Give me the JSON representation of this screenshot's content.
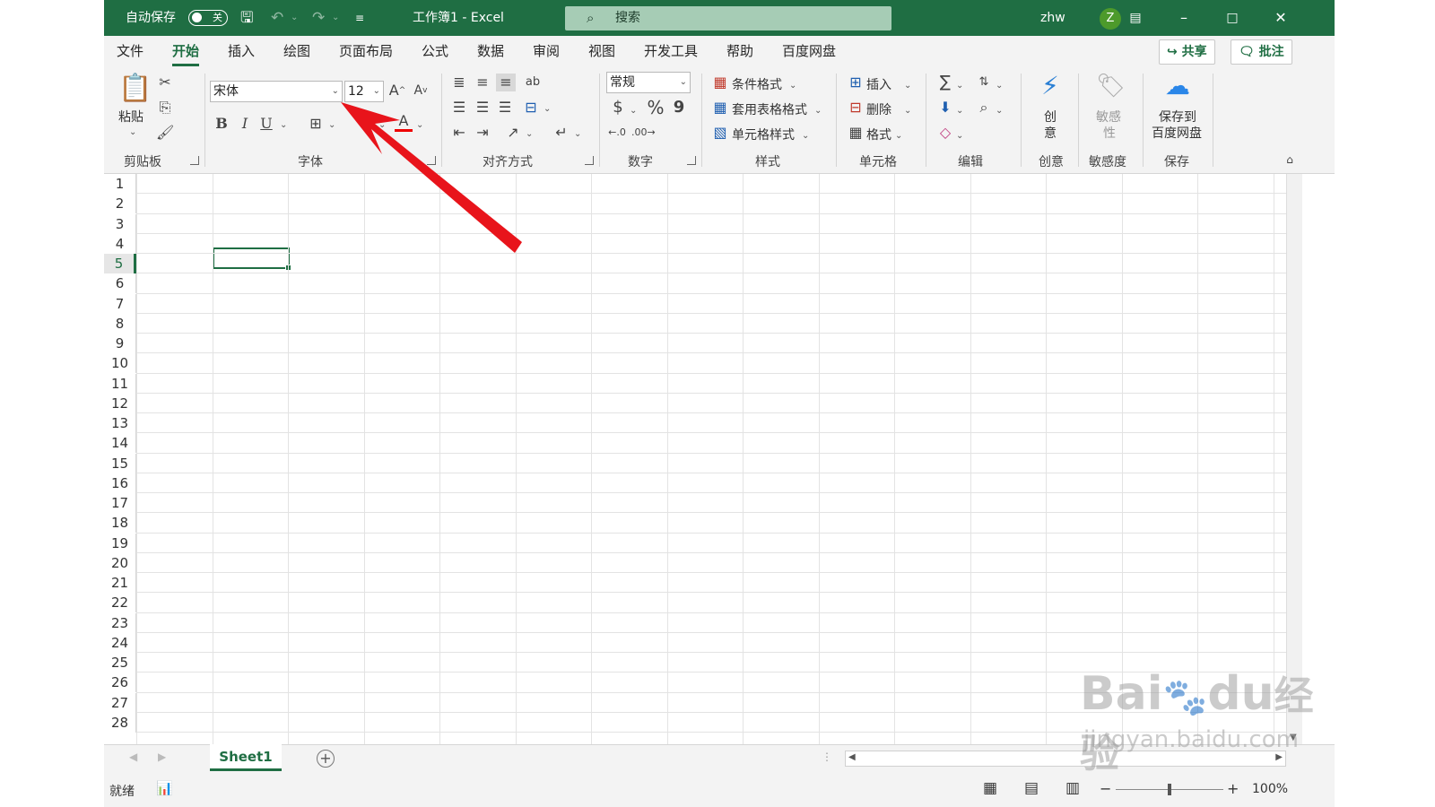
{
  "titlebar": {
    "autosave_label": "自动保存",
    "autosave_state": "关",
    "doc_title": "工作簿1  -  Excel",
    "search_placeholder": "搜索",
    "user_name": "zhw",
    "avatar_letter": "Z"
  },
  "menu": {
    "tabs": [
      "文件",
      "开始",
      "插入",
      "绘图",
      "页面布局",
      "公式",
      "数据",
      "审阅",
      "视图",
      "开发工具",
      "帮助",
      "百度网盘"
    ],
    "active_tab": "开始",
    "share_label": "共享",
    "comment_label": "批注"
  },
  "ribbon": {
    "clipboard": {
      "paste_label": "粘贴",
      "group_label": "剪贴板"
    },
    "font": {
      "font_name": "宋体",
      "font_size": "12",
      "bold": "B",
      "italic": "I",
      "underline": "U",
      "group_label": "字体"
    },
    "alignment": {
      "group_label": "对齐方式"
    },
    "number": {
      "format": "常规",
      "currency": "$",
      "percent": "%",
      "comma": "9",
      "group_label": "数字"
    },
    "styles": {
      "conditional": "条件格式",
      "table": "套用表格格式",
      "cell": "单元格样式",
      "group_label": "样式"
    },
    "cells": {
      "insert": "插入",
      "delete": "删除",
      "format": "格式",
      "group_label": "单元格"
    },
    "editing": {
      "group_label": "编辑"
    },
    "creative": {
      "label_line1": "创",
      "label_line2": "意",
      "group_label": "创意"
    },
    "sensitivity": {
      "label_line1": "敏感",
      "label_line2": "性",
      "group_label": "敏感度"
    },
    "save": {
      "label_line1": "保存到",
      "label_line2": "百度网盘",
      "group_label": "保存"
    }
  },
  "grid": {
    "rows": [
      "1",
      "2",
      "3",
      "4",
      "5",
      "6",
      "7",
      "8",
      "9",
      "10",
      "11",
      "12",
      "13",
      "14",
      "15",
      "16",
      "17",
      "18",
      "19",
      "20",
      "21",
      "22",
      "23",
      "24",
      "25",
      "26",
      "27",
      "28"
    ],
    "selected_row": "5"
  },
  "sheets": {
    "tabs": [
      "Sheet1"
    ],
    "add_symbol": "+"
  },
  "status": {
    "ready": "就绪",
    "zoom": "100%",
    "minus": "−",
    "plus": "+"
  },
  "watermark": {
    "brand": "Bai",
    "brand2": "du",
    "cn": "经验",
    "url": "jingyan.baidu.com"
  },
  "colors": {
    "accent": "#1f6e43",
    "arrow": "#e8141b"
  }
}
